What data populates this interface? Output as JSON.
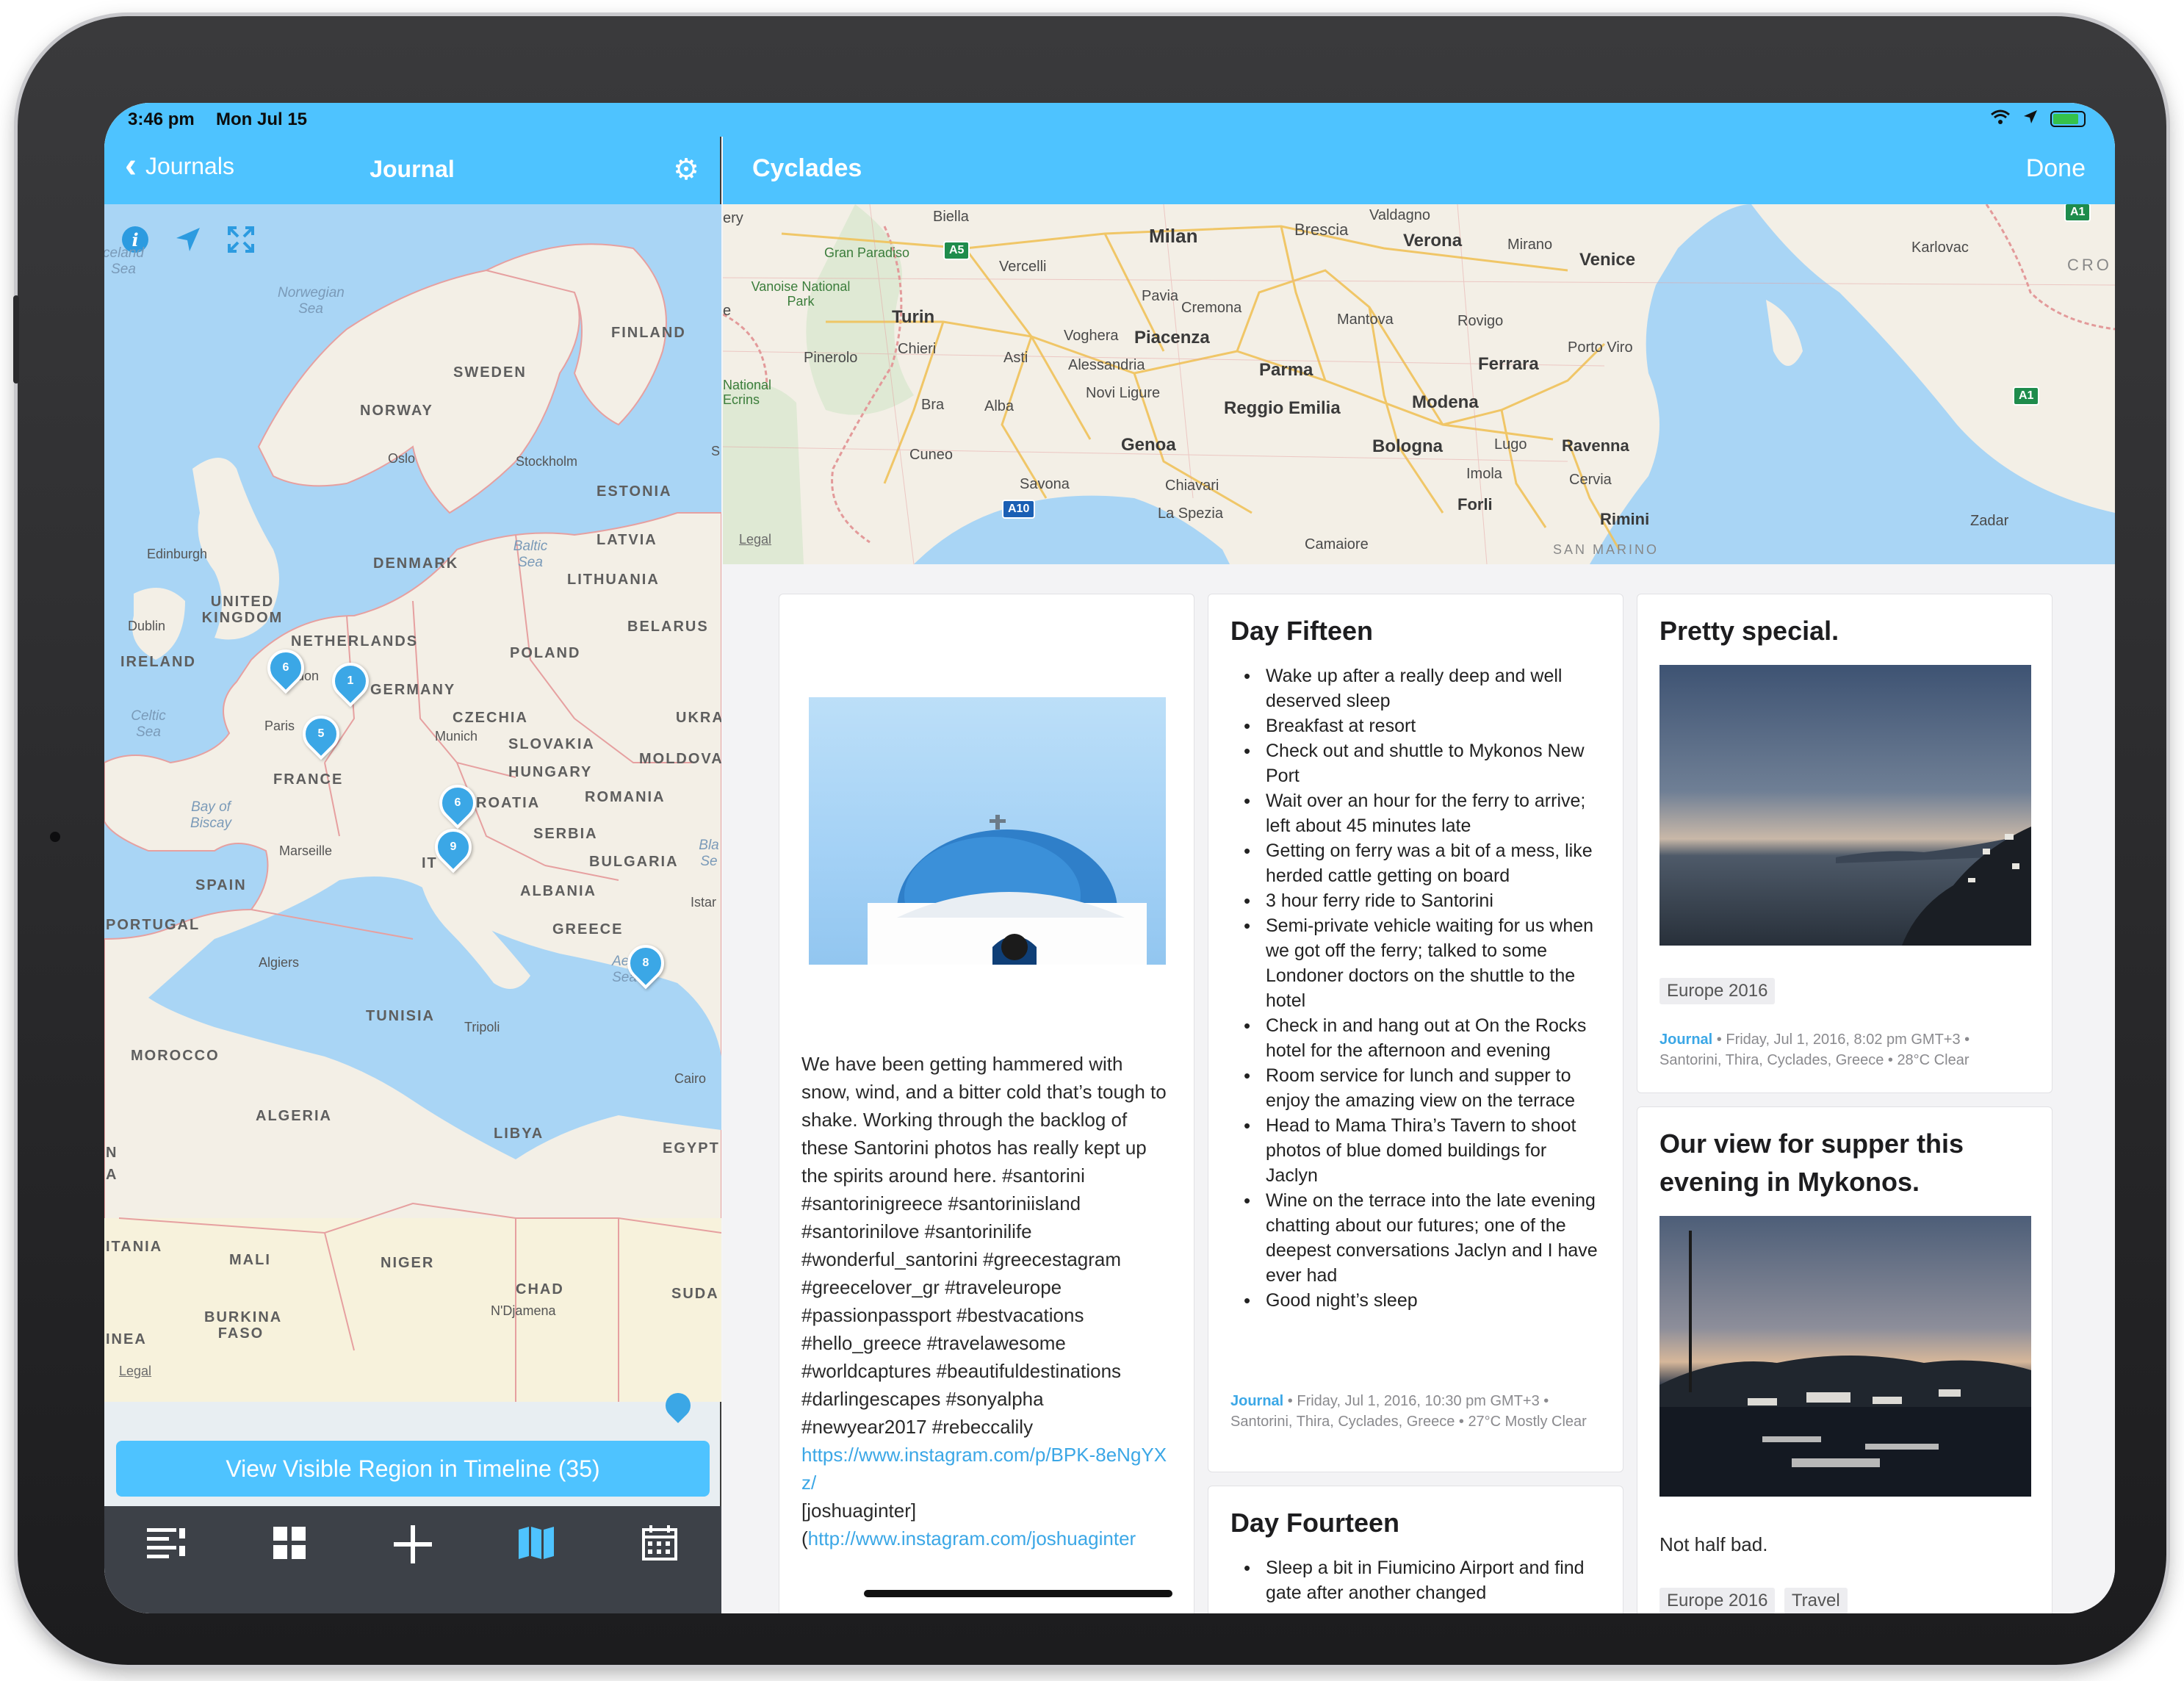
{
  "status": {
    "time": "3:46 pm",
    "date": "Mon Jul 15",
    "icons": [
      "wifi-icon",
      "location-arrow-icon",
      "battery-charging-icon"
    ]
  },
  "left_nav": {
    "back_label": "Journals",
    "title": "Journal"
  },
  "left_map": {
    "controls": [
      "info-icon",
      "location-arrow-icon",
      "fullscreen-icon"
    ],
    "legal": "Legal",
    "countries": [
      "FINLAND",
      "SWEDEN",
      "NORWAY",
      "ESTONIA",
      "LATVIA",
      "DENMARK",
      "LITHUANIA",
      "UNITED KINGDOM",
      "IRELAND",
      "NETHERLANDS",
      "BELARUS",
      "POLAND",
      "GERMANY",
      "CZECHIA",
      "UKRA",
      "SLOVAKIA",
      "MOLDOVA",
      "HUNGARY",
      "FRANCE",
      "ROMANIA",
      "ROATIA",
      "SERBIA",
      "BULGARIA",
      "ALBANIA",
      "SPAIN",
      "PORTUGAL",
      "GREECE",
      "TUNISIA",
      "MOROCCO",
      "ALGERIA",
      "LIBYA",
      "EGYPT",
      "ITANIA",
      "MALI",
      "NIGER",
      "CHAD",
      "SUDA",
      "BURKINA FASO",
      "INEA",
      "IT",
      "N",
      "A"
    ],
    "seas": [
      "celand Sea",
      "Norwegian Sea",
      "Baltic Sea",
      "Celtic Sea",
      "Bay of Biscay",
      "Bla Se",
      "Aeg Sea"
    ],
    "cities": [
      "Oslo",
      "Stockholm",
      "Edinburgh",
      "Dublin",
      "don",
      "Paris",
      "Munich",
      "Marseille",
      "Algiers",
      "Tripoli",
      "Cairo",
      "N'Djamena",
      "Istar",
      "S"
    ],
    "pins": [
      "6",
      "1",
      "5",
      "6",
      "9",
      "8"
    ]
  },
  "timeline_button": "View Visible Region in Timeline (35)",
  "tabbar": {
    "items": [
      "list-icon",
      "grid-icon",
      "add-icon",
      "map-icon",
      "calendar-icon"
    ],
    "active": "map-icon"
  },
  "right_nav": {
    "title": "Cyclades",
    "done_label": "Done"
  },
  "right_map": {
    "legal": "Legal",
    "cities": [
      "Biella",
      "Milan",
      "Brescia",
      "Valdagno",
      "Verona",
      "Mirano",
      "Venice",
      "Karlovac",
      "CRO",
      "Gran Paradiso",
      "Vercelli",
      "Vanoise National Park",
      "Pavia",
      "Cremona",
      "Mantova",
      "Rovigo",
      "Turin",
      "Chieri",
      "Voghera",
      "Piacenza",
      "Porto Viro",
      "Pinerolo",
      "Asti",
      "Alessandria",
      "Parma",
      "Ferrara",
      "National Ecrins",
      "Novi Ligure",
      "Bra",
      "Alba",
      "Reggio Emilia",
      "Modena",
      "Cuneo",
      "Genoa",
      "Bologna",
      "Lugo",
      "Ravenna",
      "Imola",
      "Cervia",
      "Savona",
      "Chiavari",
      "Forli",
      "La Spezia",
      "Rimini",
      "Zadar",
      "Camaiore",
      "SAN MARINO",
      "ery",
      "e"
    ],
    "shields": [
      "A5",
      "A10",
      "A1",
      "A1"
    ]
  },
  "cards": {
    "photo_post": {
      "body": "We have been getting hammered with snow, wind, and a bitter cold that’s tough to shake. Working through the backlog of these Santorini photos has really kept up the spirits around here. #santorini #santorinigreece #santoriniisland #santorinilove #santorinilife #wonderful_santorini #greecestagram #greecelover_gr #traveleurope #passionpassport #bestvacations #hello_greece #travelawesome #worldcaptures #beautifuldestinations #darlingescapes #sonyalpha #newyear2017 #rebeccalily",
      "link1": "https://www.instagram.com/p/BPK-8eNgYXz/",
      "handle": "[joshuaginter]",
      "open_paren": "(",
      "link2": "http://www.instagram.com/joshuaginter"
    },
    "day_fifteen": {
      "title": "Day Fifteen",
      "items": [
        "Wake up after a really deep and well deserved sleep",
        "Breakfast at resort",
        "Check out and shuttle to Mykonos New Port",
        "Wait over an hour for the ferry to arrive; left about 45 minutes late",
        "Getting on ferry was a bit of a mess, like herded cattle getting on board",
        "3 hour ferry ride to Santorini",
        "Semi-private vehicle waiting for us when we got off the ferry; talked to some Londoner doctors on the shuttle to the hotel",
        "Check in and hang out at On the Rocks hotel for the afternoon and evening",
        "Room service for lunch and supper to enjoy the amazing view on the terrace",
        "Head to Mama Thira’s Tavern to shoot photos of blue domed buildings for Jaclyn",
        "Wine on the terrace into the late evening chatting about our futures; one of the deepest conversations Jaclyn and I have ever had",
        "Good night’s sleep"
      ],
      "meta_journal": "Journal",
      "meta_rest": " • Friday, Jul 1, 2016, 10:30 pm GMT+3 • Santorini, Thira, Cyclades, Greece • 27°C Mostly Clear"
    },
    "day_fourteen": {
      "title": "Day Fourteen",
      "items": [
        "Sleep a bit in Fiumicino Airport and find gate after another changed"
      ]
    },
    "pretty_special": {
      "title": "Pretty special.",
      "tag": "Europe 2016",
      "meta_journal": "Journal",
      "meta_rest": " • Friday, Jul 1, 2016, 8:02 pm GMT+3 • Santorini, Thira, Cyclades, Greece • 28°C Clear"
    },
    "mykonos": {
      "title": "Our view for supper this evening in Mykonos.",
      "body": "Not half bad.",
      "tags": [
        "Europe 2016",
        "Travel"
      ]
    }
  },
  "colors": {
    "accent": "#4EC3FF",
    "tabbar": "#3D4148",
    "link": "#3BA7E6",
    "water": "#A9D5F5",
    "land": "#F3EFE6"
  }
}
